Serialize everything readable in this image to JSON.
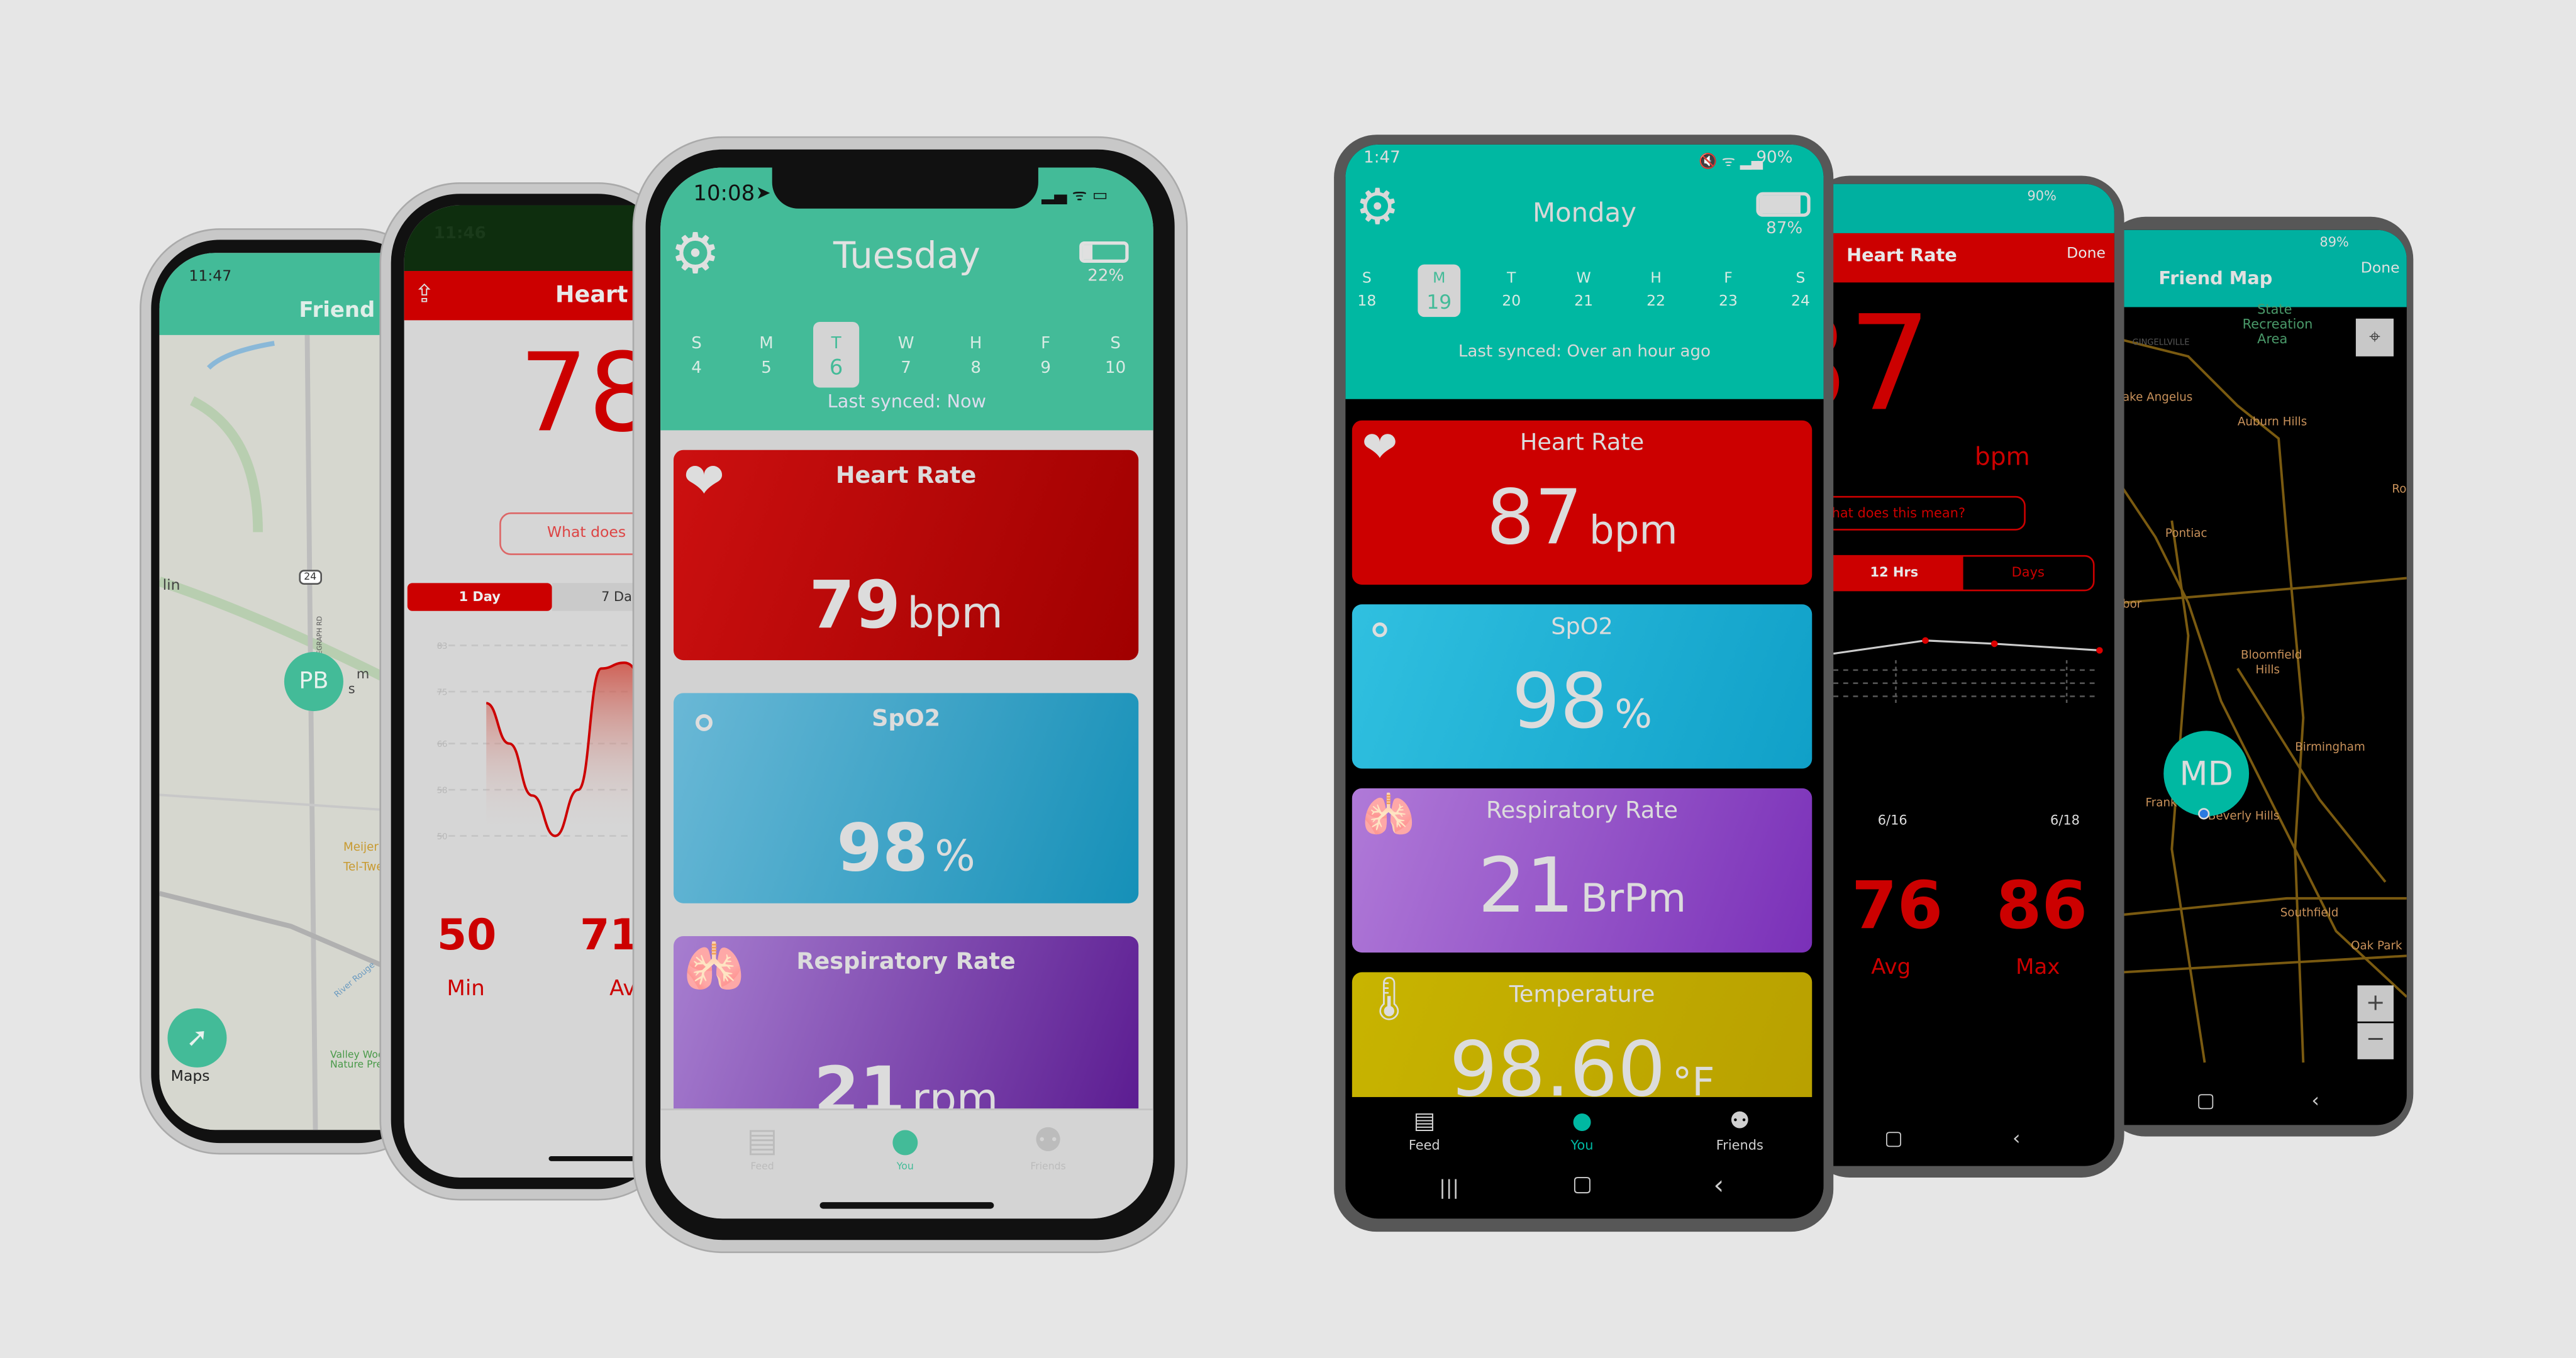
{
  "colors": {
    "ios_green": "#43bb98",
    "android_teal": "#00b8a2",
    "heart_red": "#cc0000",
    "spo2_blue": "#2aa8cc",
    "resp_purple": "#8a54b8",
    "temp_yellow": "#c4ae00",
    "background": "#e6e6e6"
  },
  "phone_friend_map_ios": {
    "status_time": "11:47",
    "title": "Friend M",
    "avatar_initials": "PB",
    "map_labels": [
      "lin",
      "24",
      "TELEGRAPH RD",
      "m",
      "s",
      "Meijer",
      "Tel-Twe",
      "River Rouge",
      "Valley Woo",
      "Nature Pre"
    ],
    "maps_brand": "Maps",
    "locate_icon": "locate-arrow"
  },
  "phone_heart_ios": {
    "status_time": "11:46",
    "title": "Heart",
    "value": "78",
    "info_button": "What does",
    "tabs": [
      {
        "label": "1 Day",
        "active": true
      },
      {
        "label": "7 Da",
        "active": false
      }
    ],
    "chart_yticks": [
      "83",
      "75",
      "66",
      "58",
      "50"
    ],
    "chart_data": {
      "type": "area",
      "yticks": [
        83,
        75,
        66,
        58,
        50
      ],
      "ylim": [
        50,
        83
      ],
      "values": [
        73,
        66,
        57,
        50,
        58,
        79,
        80,
        77,
        74,
        73,
        66,
        62,
        61
      ]
    },
    "stats": [
      {
        "value": "50",
        "label": "Min"
      },
      {
        "value": "71",
        "label": "Av"
      }
    ]
  },
  "phone_main_ios": {
    "status_time": "10:08",
    "day_title": "Tuesday",
    "battery_percent": "22%",
    "battery_level": 0.22,
    "week": [
      {
        "d": "S",
        "n": "4"
      },
      {
        "d": "M",
        "n": "5"
      },
      {
        "d": "T",
        "n": "6",
        "selected": true
      },
      {
        "d": "W",
        "n": "7"
      },
      {
        "d": "H",
        "n": "8"
      },
      {
        "d": "F",
        "n": "9"
      },
      {
        "d": "S",
        "n": "10"
      }
    ],
    "last_synced": "Last synced: Now",
    "cards": [
      {
        "title": "Heart Rate",
        "value": "79",
        "unit": "bpm",
        "icon": "heart"
      },
      {
        "title": "SpO2",
        "value": "98",
        "unit": "%",
        "icon": "bubbles"
      },
      {
        "title": "Respiratory Rate",
        "value": "21",
        "unit": "rpm",
        "icon": "lungs"
      }
    ],
    "tabs": [
      {
        "label": "Feed",
        "icon": "newspaper"
      },
      {
        "label": "You",
        "icon": "person",
        "active": true
      },
      {
        "label": "Friends",
        "icon": "people"
      }
    ]
  },
  "phone_main_android": {
    "status_time": "1:47",
    "status_battery": "90%",
    "day_title": "Monday",
    "battery_percent": "87%",
    "battery_level": 0.87,
    "week": [
      {
        "d": "S",
        "n": "18"
      },
      {
        "d": "M",
        "n": "19",
        "selected": true
      },
      {
        "d": "T",
        "n": "20"
      },
      {
        "d": "W",
        "n": "21"
      },
      {
        "d": "H",
        "n": "22"
      },
      {
        "d": "F",
        "n": "23"
      },
      {
        "d": "S",
        "n": "24"
      }
    ],
    "last_synced": "Last synced: Over an hour ago",
    "cards": [
      {
        "title": "Heart Rate",
        "value": "87",
        "unit": "bpm",
        "icon": "heart"
      },
      {
        "title": "SpO2",
        "value": "98",
        "unit": "%",
        "icon": "bubbles"
      },
      {
        "title": "Respiratory Rate",
        "value": "21",
        "unit": "BrPm",
        "icon": "lungs"
      },
      {
        "title": "Temperature",
        "value": "98.60",
        "unit": "°F",
        "icon": "thermometer"
      }
    ],
    "tabs": [
      {
        "label": "Feed",
        "icon": "document"
      },
      {
        "label": "You",
        "icon": "person",
        "active": true
      },
      {
        "label": "Friends",
        "icon": "people"
      }
    ]
  },
  "phone_heart_android": {
    "status_battery": "90%",
    "title": "Heart Rate",
    "done": "Done",
    "value": "87",
    "unit": "bpm",
    "info_button": "hat does this mean?",
    "tabs": [
      {
        "label": "12 Hrs",
        "active": true
      },
      {
        "label": "Days",
        "active": false
      }
    ],
    "chart_data": {
      "type": "line",
      "x_labels": [
        "6/16",
        "6/18"
      ],
      "values": [
        84,
        86,
        85.5,
        84.5
      ]
    },
    "stats": [
      {
        "value": "76",
        "label": "Avg"
      },
      {
        "value": "86",
        "label": "Max"
      }
    ]
  },
  "phone_map_android": {
    "status_battery": "89%",
    "title": "Friend Map",
    "done": "Done",
    "avatar_initials": "MD",
    "map_labels": [
      "State",
      "Recreation",
      "Area",
      "GINGELLVILLE",
      "ake Angelus",
      "Auburn Hills",
      "Pontiac",
      "Ro",
      "bor",
      "Bloomfield",
      "Hills",
      "Birmingham",
      "Frank",
      "Beverly Hills",
      "Southfield",
      "Oak Park"
    ],
    "zoom_in": "+",
    "zoom_out": "−"
  }
}
